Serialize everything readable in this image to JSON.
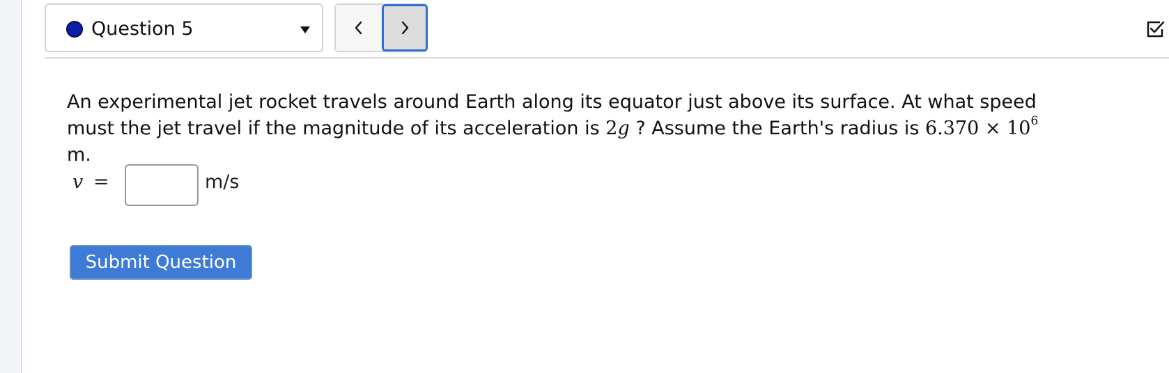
{
  "header": {
    "question_label": "Question 5",
    "status": "unanswered",
    "status_color": "#0b1fa8",
    "prev_icon": "chevron-left-icon",
    "next_icon": "chevron-right-icon",
    "dropdown_icon": "caret-down-icon",
    "checklist_icon": "checklist-icon"
  },
  "problem": {
    "text_part1": "An experimental jet rocket travels around Earth along its equator just above its surface. At what speed must the jet travel if the magnitude of its acceleration is ",
    "accel_coefficient": "2",
    "accel_symbol": "g",
    "text_part2": " ? Assume the Earth's radius is ",
    "radius_mantissa": "6.370",
    "times_symbol": "×",
    "radius_base": "10",
    "radius_exponent": "6",
    "radius_unit": " m."
  },
  "answer": {
    "variable": "v",
    "equals": "=",
    "value": "",
    "placeholder": "",
    "unit": "m/s"
  },
  "actions": {
    "submit_label": "Submit Question"
  },
  "colors": {
    "accent": "#3e7bd6",
    "focus_ring": "#2f6fd3"
  }
}
